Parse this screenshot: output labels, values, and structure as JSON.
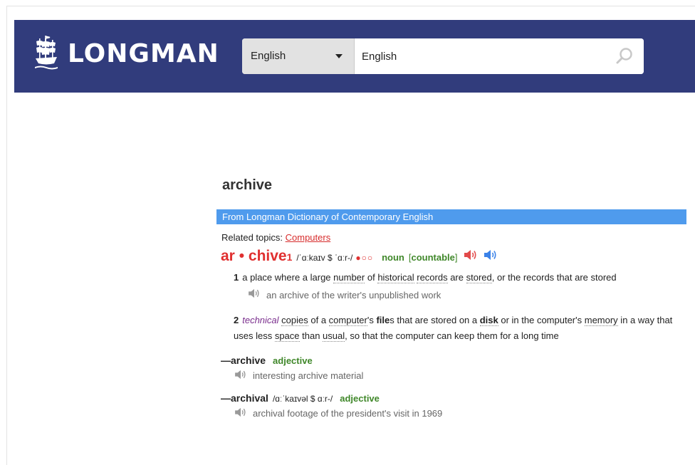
{
  "header": {
    "logo_text": "LONGMAN",
    "dictionary_select": "English",
    "search_placeholder": "English"
  },
  "page": {
    "headword": "archive",
    "dictionary_name": "From Longman Dictionary of Contemporary English",
    "related_label": "Related topics:",
    "related_topic": "Computers"
  },
  "entry": {
    "hw_a": "ar",
    "hw_dot": " • ",
    "hw_b": "chive",
    "hw_num": "1",
    "pron_a": "/ˈɑːkaɪv $ ˈɑːr-/",
    "freq": "●○○",
    "pos": "noun",
    "gram_open": "[",
    "gram": "countable",
    "gram_close": "]",
    "sense1": {
      "num": "1",
      "t1": "a place where a large ",
      "w1": "number",
      "t2": " of ",
      "w2": "historical",
      "t3": " ",
      "w3": "records",
      "t4": " are ",
      "w4": "stored",
      "t5": ", or the records that are stored",
      "example": "an archive of the writer's unpublished work"
    },
    "sense2": {
      "num": "2",
      "register": "technical",
      "w1": "copies",
      "t1": " of a ",
      "w2": "computer",
      "t2": "'s ",
      "w3": "file",
      "t3": "s that are stored on a ",
      "w4": "disk",
      "t4": " or in the computer's ",
      "w5": "memory",
      "t5": " in a way that uses less ",
      "w6": "space",
      "t6": " than ",
      "w7": "usual",
      "t7": ", so that the computer can keep them for a long time"
    }
  },
  "runons": [
    {
      "dash": "—",
      "word": "archive",
      "pos": "adjective",
      "example": "interesting archive material"
    },
    {
      "dash": "—",
      "word": "archival",
      "pron": "/ɑːˈkaɪvəl $ ɑːr-/",
      "pos": "adjective",
      "example": "archival footage of the president's visit in 1969"
    }
  ],
  "colors": {
    "header_bg": "#313c7c",
    "headword_red": "#e03030",
    "pos_green": "#3f8729",
    "bar_blue": "#4f9bed",
    "register_purple": "#7b2f8e"
  },
  "icons": {
    "logo": "ship-icon",
    "search": "search-icon",
    "british_audio": "speaker-icon",
    "american_audio": "speaker-icon",
    "example_audio": "speaker-icon"
  }
}
